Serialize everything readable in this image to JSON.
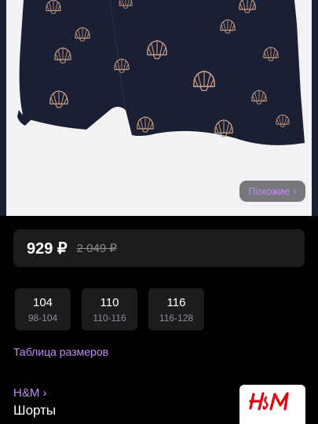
{
  "similar_button": {
    "label": "Похожие",
    "chevron": "›"
  },
  "price": {
    "current": "929 ₽",
    "old": "2 049 ₽"
  },
  "sizes": [
    {
      "size": "104",
      "range": "98-104"
    },
    {
      "size": "110",
      "range": "110-116"
    },
    {
      "size": "116",
      "range": "116-128"
    }
  ],
  "size_table_link": "Таблица размеров",
  "brand": {
    "name": "H&M",
    "chevron": "›",
    "logo_icon": "hm-logo"
  },
  "product": {
    "title": "Шорты"
  },
  "colors": {
    "accent": "#c48bf5",
    "card_bg": "#1c1c1f",
    "page_bg": "#000000",
    "fabric": "#1b1f33",
    "print": "#c99d86"
  }
}
